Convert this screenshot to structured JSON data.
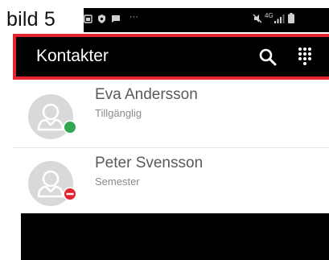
{
  "caption": "bild 5",
  "statusbar": {
    "dots": "···",
    "network": "4G"
  },
  "appbar": {
    "title": "Kontakter",
    "icons": [
      "search-icon",
      "dialpad-icon"
    ]
  },
  "contacts": [
    {
      "name": "Eva Andersson",
      "status": "Tillgänglig",
      "presence": "available",
      "presence_color": "#2fa84f"
    },
    {
      "name": "Peter Svensson",
      "status": "Semester",
      "presence": "do-not-disturb",
      "presence_color": "#e32430"
    }
  ],
  "colors": {
    "highlight": "#e3262f",
    "appbar": "#000000",
    "avatar": "#d9d9d9"
  }
}
